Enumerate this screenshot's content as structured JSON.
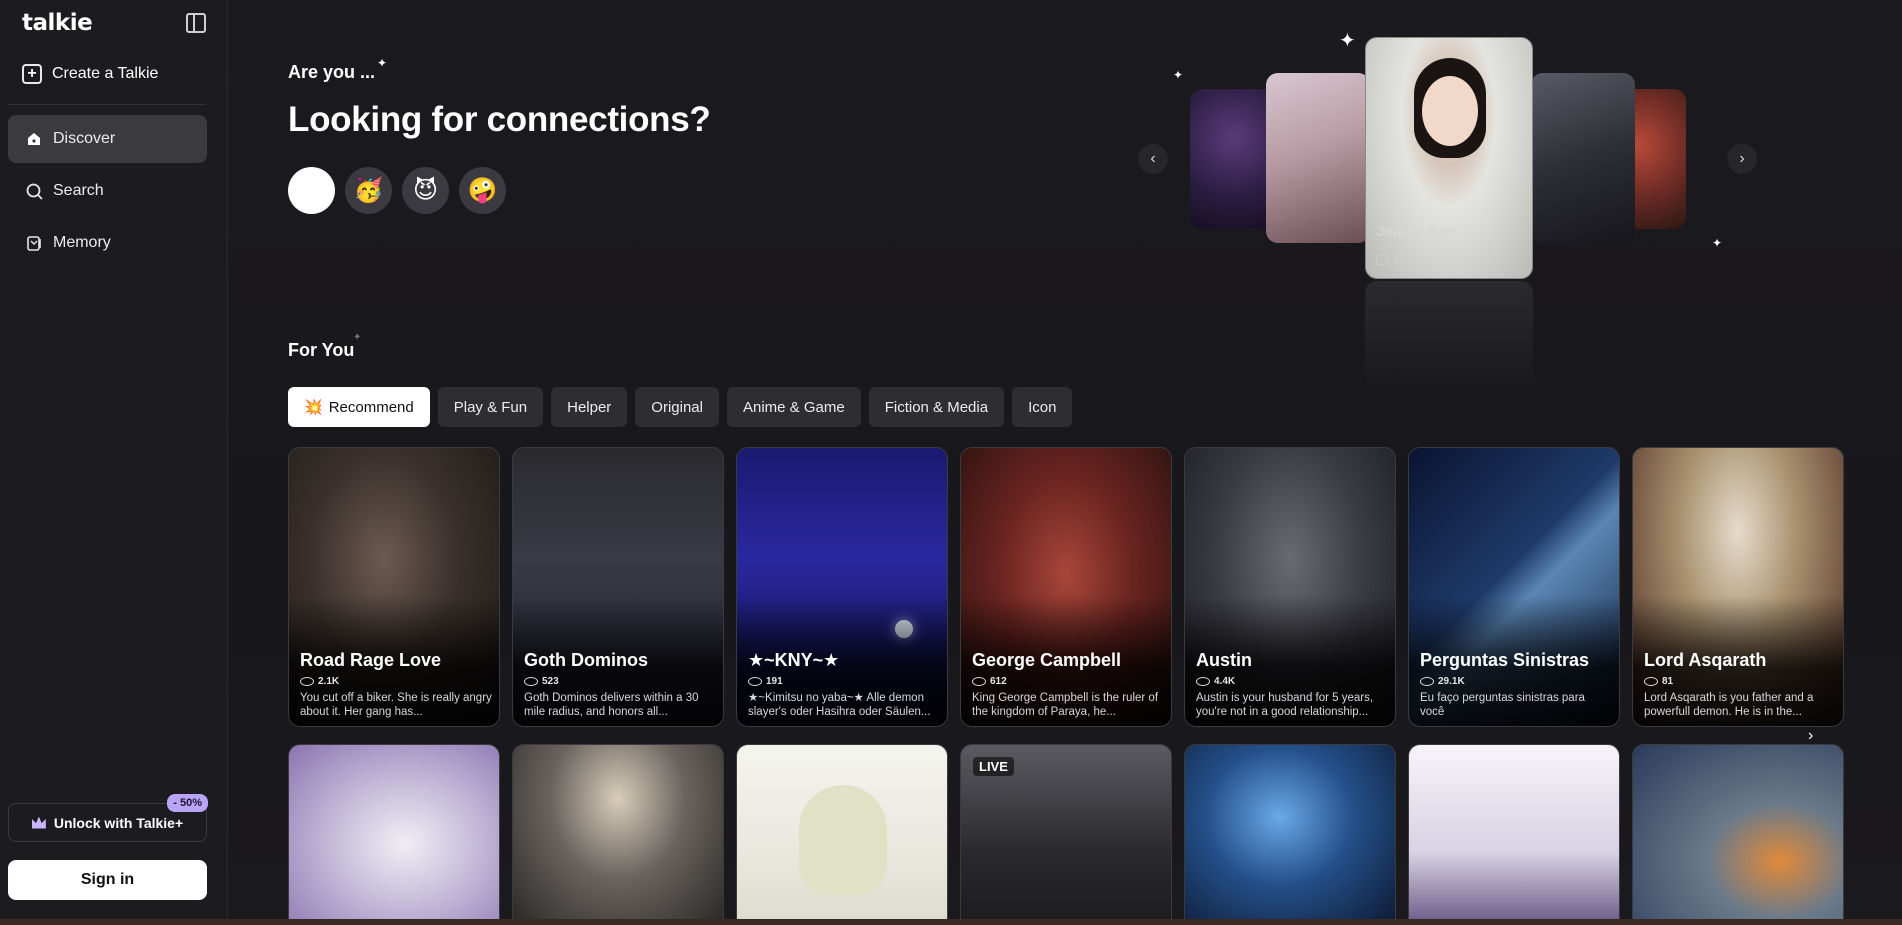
{
  "sidebar": {
    "logo": "talkie",
    "create": "Create a Talkie",
    "nav": [
      {
        "label": "Discover",
        "icon": "discover-icon"
      },
      {
        "label": "Search",
        "icon": "search-icon"
      },
      {
        "label": "Memory",
        "icon": "memory-icon"
      }
    ],
    "unlock": "Unlock with Talkie+",
    "discount": "- 50%",
    "signin": "Sign in"
  },
  "hero": {
    "are_you": "Are you ...",
    "headline": "Looking for connections?",
    "emojis": [
      "😍",
      "🥳",
      "😈",
      "🤪"
    ],
    "featured": {
      "name": "Jennie Kim",
      "count": "14.6K"
    }
  },
  "for_you": {
    "title": "For You",
    "filters": [
      "Recommend",
      "Play & Fun",
      "Helper",
      "Original",
      "Anime & Game",
      "Fiction & Media",
      "Icon"
    ]
  },
  "cards": [
    {
      "name": "Road Rage Love",
      "count": "2.1K",
      "desc": "You cut off a biker. She is really angry about it. Her gang has..."
    },
    {
      "name": "Goth Dominos",
      "count": "523",
      "desc": "Goth Dominos delivers within a 30 mile radius, and honors all..."
    },
    {
      "name": "★~KNY~★",
      "count": "191",
      "desc": "★~Kimitsu no yaba~★ Alle demon slayer's oder Hasihra oder Säulen..."
    },
    {
      "name": "George Campbell",
      "count": "612",
      "desc": "King George Campbell is the ruler of the kingdom of Paraya, he..."
    },
    {
      "name": "Austin",
      "count": "4.4K",
      "desc": "Austin is your husband for 5 years, you're not in a good relationship..."
    },
    {
      "name": "Perguntas Sinistras",
      "count": "29.1K",
      "desc": "Eu faço perguntas sinistras para você"
    },
    {
      "name": "Lord Asqarath",
      "count": "81",
      "desc": "Lord Asqarath is you father and a powerfull demon. He is in the..."
    }
  ],
  "second_row": {
    "live_label": "LIVE"
  },
  "colors": {
    "accent": "#b9a4f5",
    "sidebar_bg": "#1c1c20",
    "main_bg": "#19181c"
  }
}
